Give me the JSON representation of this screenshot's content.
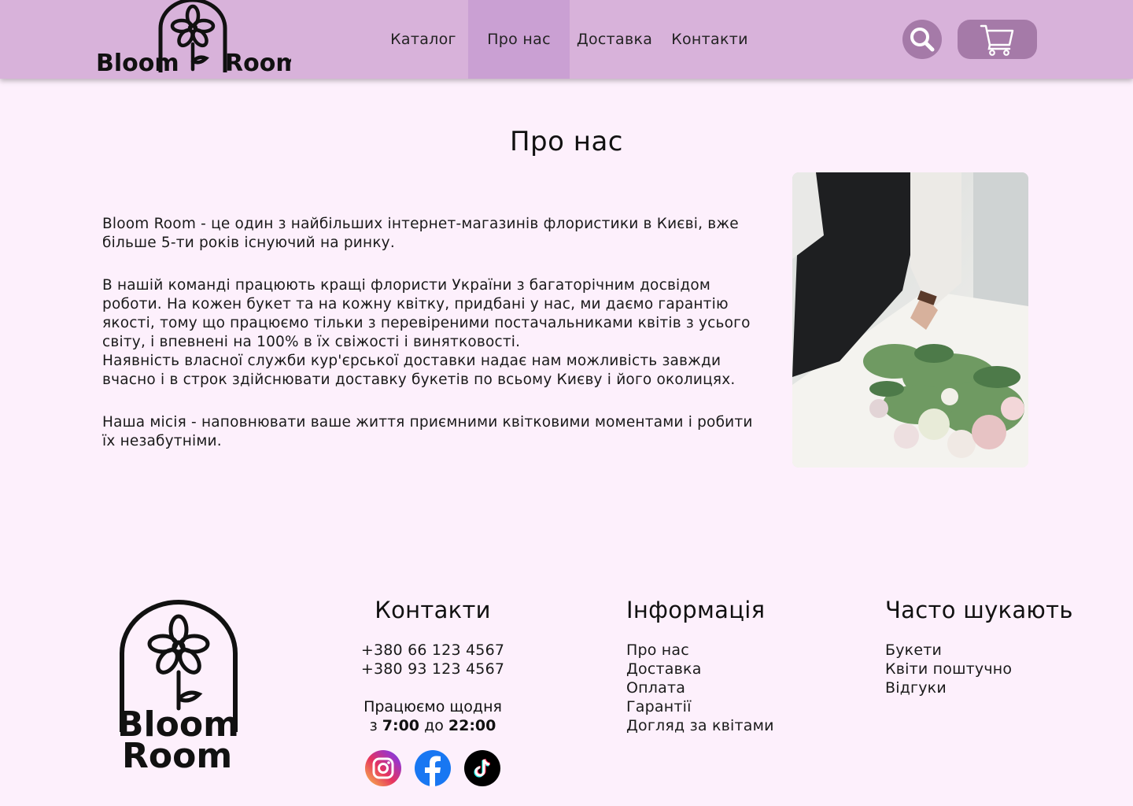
{
  "brand": {
    "logo_text_left": "Bloom",
    "logo_text_right": "Room",
    "footer_line1": "Bloom",
    "footer_line2": "Room"
  },
  "nav": {
    "items": [
      {
        "label": "Каталог"
      },
      {
        "label": "Про нас",
        "active": true
      },
      {
        "label": "Доставка"
      },
      {
        "label": "Контакти"
      }
    ]
  },
  "header_icons": {
    "search": "search-icon",
    "cart": "cart-icon"
  },
  "page": {
    "title": "Про нас",
    "paragraphs": [
      "Bloom Room - це один з найбільших інтернет-магазинів флористики в Києві, вже більше 5-ти років існуючий на ринку.",
      "В нашій команді працюють кращі флористи України з багаторічним досвідом роботи. На кожен букет та на кожну квітку, придбані у нас, ми даємо гарантію якості, тому що працюємо тільки з перевіреними постачальниками квітів з усього світу, і впевнені на 100% в їх свіжості і винятковості.",
      "Наявність власної служби кур'єрської доставки надає нам можливість завжди вчасно і в строк здійснювати доставку букетів по всьому Києву і його околицях.",
      "Наша місія - наповнювати ваше життя приємними квітковими моментами і робити їх незабутніми."
    ]
  },
  "footer": {
    "contacts": {
      "title": "Контакти",
      "phones": [
        "+380 66 123 4567",
        "+380 93 123 4567"
      ],
      "hours_line1": "Працюємо щодня",
      "hours_from_prefix": "з",
      "hours_from": "7:00",
      "hours_to_prefix": "до",
      "hours_to": "22:00"
    },
    "socials": [
      "instagram-icon",
      "facebook-icon",
      "tiktok-icon"
    ],
    "info": {
      "title": "Інформація",
      "links": [
        "Про нас",
        "Доставка",
        "Оплата",
        "Гарантії",
        "Догляд за квітами"
      ]
    },
    "often": {
      "title": "Часто шукають",
      "links": [
        "Букети",
        "Квіти поштучно",
        "Відгуки"
      ]
    }
  },
  "colors": {
    "header_bg": "#d8b2da",
    "nav_active": "#caa0d3",
    "icon_button": "#a57aa8",
    "page_bg": "#fdf0fc"
  }
}
